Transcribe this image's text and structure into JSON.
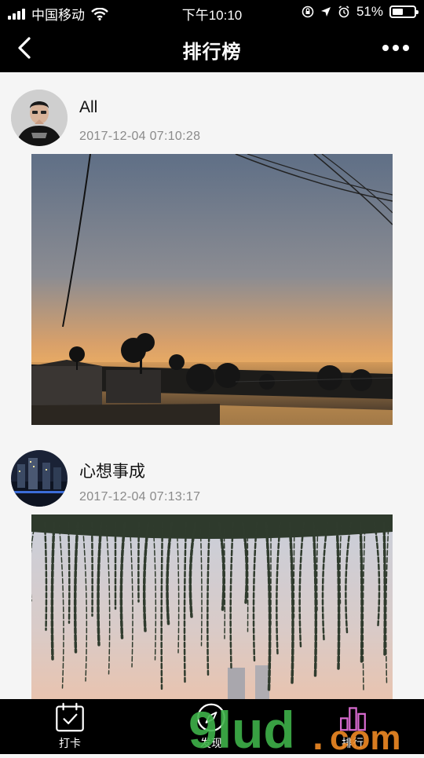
{
  "status_bar": {
    "carrier": "中国移动",
    "time": "下午10:10",
    "battery_percent": "51%",
    "battery_level": 0.51,
    "icons": [
      "signal-icon",
      "wifi-icon",
      "rotation-lock-icon",
      "location-icon",
      "alarm-icon",
      "battery-icon"
    ]
  },
  "nav_bar": {
    "title": "排行榜",
    "back_icon": "back-icon",
    "more_icon": "more-icon"
  },
  "feed": {
    "posts": [
      {
        "username": "All",
        "timestamp": "2017-12-04 07:10:28",
        "photo": "sunset-over-pond-photo"
      },
      {
        "username": "心想事成",
        "timestamp": "2017-12-04 07:13:17",
        "photo": "willow-branches-dawn-photo"
      }
    ]
  },
  "tab_bar": {
    "tabs": [
      {
        "label": "打卡",
        "icon": "calendar-check-icon"
      },
      {
        "label": "发现",
        "icon": "compass-icon"
      },
      {
        "label": "排行",
        "icon": "ranking-icon"
      }
    ]
  },
  "watermark": {
    "text_main": "9lud",
    "text_dot": ".",
    "text_com": "com"
  },
  "colors": {
    "bar_background": "#000000",
    "feed_background": "#f5f5f5",
    "timestamp_gray": "#8a8a8a",
    "watermark_green": "#3fb24a",
    "watermark_orange": "#f08a24"
  }
}
